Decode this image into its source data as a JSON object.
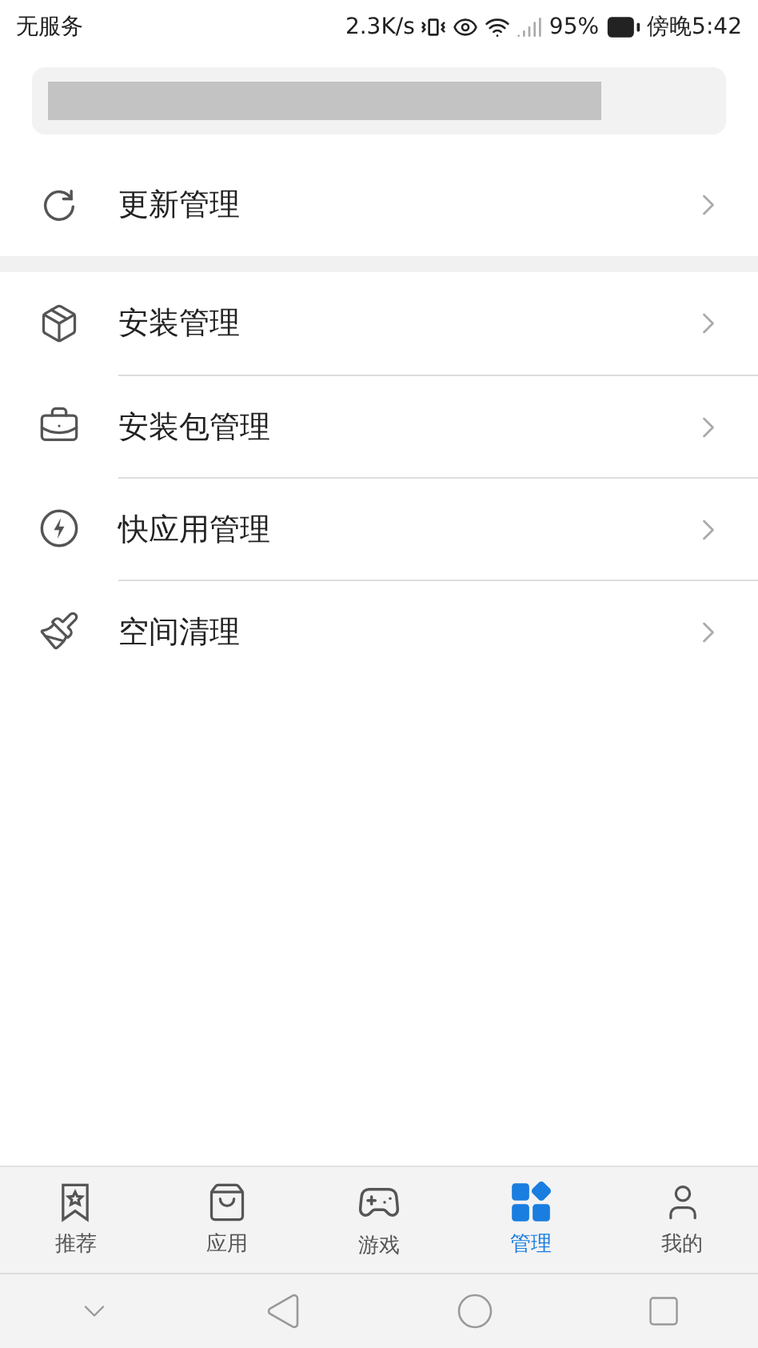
{
  "status_bar": {
    "carrier": "无服务",
    "speed": "2.3K/s",
    "battery": "95%",
    "time": "傍晚5:42"
  },
  "search": {
    "kind": "redacted"
  },
  "sections": [
    {
      "items": [
        {
          "label": "更新管理"
        }
      ]
    },
    {
      "items": [
        {
          "label": "安装管理"
        },
        {
          "label": "安装包管理"
        },
        {
          "label": "快应用管理"
        },
        {
          "label": "空间清理"
        }
      ]
    }
  ],
  "tabs": [
    {
      "label": "推荐",
      "selected": false
    },
    {
      "label": "应用",
      "selected": false
    },
    {
      "label": "游戏",
      "selected": false
    },
    {
      "label": "管理",
      "selected": true
    },
    {
      "label": "我的",
      "selected": false
    }
  ]
}
